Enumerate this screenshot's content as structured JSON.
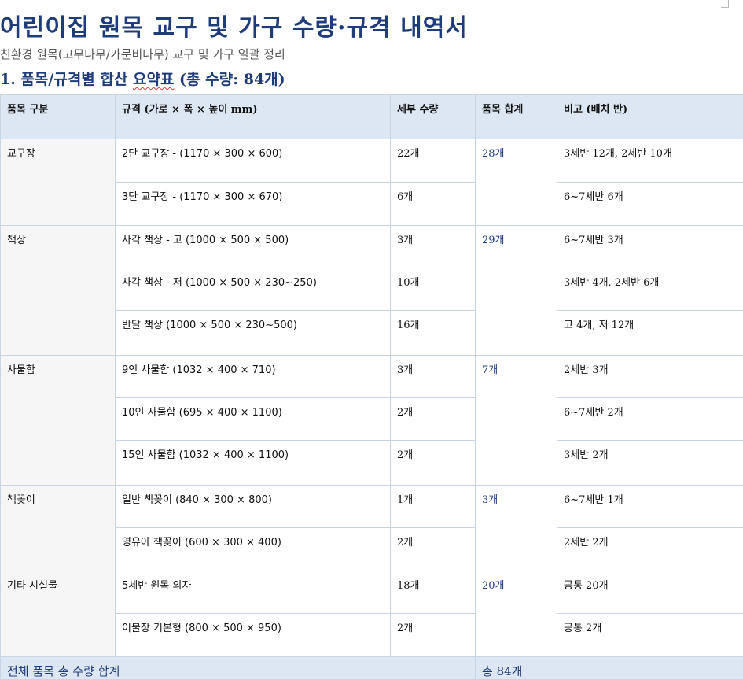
{
  "title": "어린이집 원목 교구 및 가구 수량·규격 내역서",
  "subtitle": "친환경 원목(고무나무/가문비나무) 교구 및 가구 일괄 정리",
  "section": {
    "prefix": "1. 품목/규격별 합산 ",
    "underlined": "요약표",
    "suffix": " (총 수량: 84개)"
  },
  "table": {
    "headers": [
      "품목 구분",
      "규격 (가로 × 폭 × 높이 mm)",
      "세부 수량",
      "품목 합계",
      "비고 (배치 반)"
    ],
    "groups": [
      {
        "category": "교구장",
        "total": "28개",
        "rows": [
          {
            "spec": "2단 교구장   -   (1170 × 300 × 600)",
            "qty": "22개",
            "note": "3세반 12개,   2세반 10개"
          },
          {
            "spec": "3단 교구장   -   (1170 × 300 × 670)",
            "qty": "6개",
            "note": "6~7세반 6개"
          }
        ]
      },
      {
        "category": "책상",
        "total": "29개",
        "rows": [
          {
            "spec": "사각 책상   - 고 (1000 × 500 × 500)",
            "qty": "3개",
            "note": "6~7세반 3개"
          },
          {
            "spec": "사각 책상   - 저 (1000 × 500 × 230~250)",
            "qty": "10개",
            "note": "3세반 4개,   2세반 6개"
          },
          {
            "spec": "반달 책상   (1000 × 500 × 230~500)",
            "qty": "16개",
            "note": "고 4개,   저 12개"
          }
        ]
      },
      {
        "category": "사물함",
        "total": "7개",
        "rows": [
          {
            "spec": "9인 사물함   (1032 × 400 × 710)",
            "qty": "3개",
            "note": "2세반 3개"
          },
          {
            "spec": "10인 사물함   (695 × 400 × 1100)",
            "qty": "2개",
            "note": "6~7세반 2개"
          },
          {
            "spec": "15인 사물함   (1032 × 400 × 1100)",
            "qty": "2개",
            "note": "3세반 2개"
          }
        ]
      },
      {
        "category": "책꽂이",
        "total": "3개",
        "rows": [
          {
            "spec": "일반 책꽂이   (840 × 300 × 800)",
            "qty": "1개",
            "note": "6~7세반 1개"
          },
          {
            "spec": "영유아 책꽂이   (600 × 300 × 400)",
            "qty": "2개",
            "note": "2세반 2개"
          }
        ]
      },
      {
        "category": "기타 시설물",
        "total": "20개",
        "rows": [
          {
            "spec": "5세반 원목   의자",
            "qty": "18개",
            "note": "공통 20개"
          },
          {
            "spec": "이불장 기본형   (800 × 500 × 950)",
            "qty": "2개",
            "note": "공통 2개"
          }
        ]
      }
    ],
    "footer": {
      "label": "전체 품목 총 수량 합계",
      "total": "총 84개"
    }
  }
}
